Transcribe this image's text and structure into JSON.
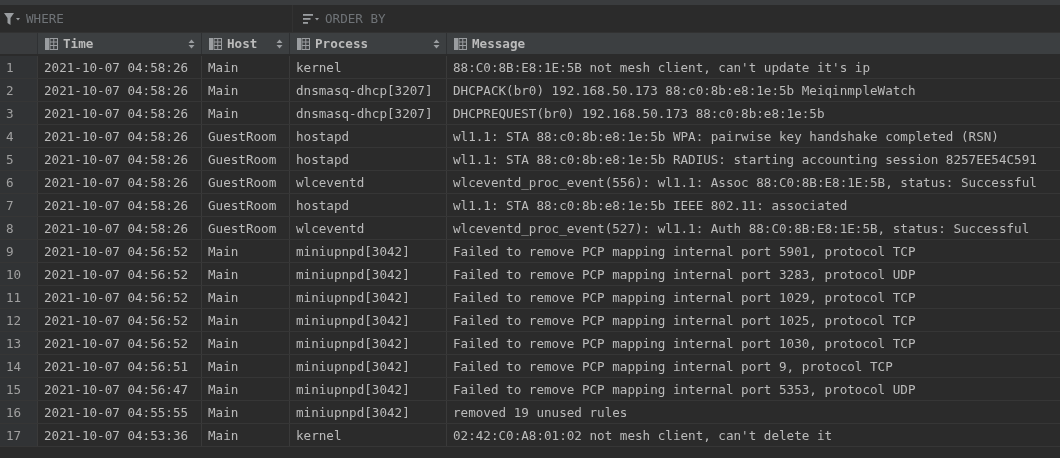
{
  "filter_bar": {
    "where": {
      "placeholder": "WHERE"
    },
    "order_by": {
      "placeholder": "ORDER BY"
    }
  },
  "table": {
    "columns": [
      {
        "label": "Time",
        "sortable": true
      },
      {
        "label": "Host",
        "sortable": true
      },
      {
        "label": "Process",
        "sortable": true
      },
      {
        "label": "Message",
        "sortable": false
      }
    ],
    "rows": [
      {
        "index": "1",
        "cells": [
          "2021-10-07 04:58:26",
          "Main",
          "kernel",
          "88:C0:8B:E8:1E:5B not mesh client, can't update it's ip"
        ]
      },
      {
        "index": "2",
        "cells": [
          "2021-10-07 04:58:26",
          "Main",
          "dnsmasq-dhcp[3207]",
          "DHCPACK(br0) 192.168.50.173 88:c0:8b:e8:1e:5b MeiqinmpleWatch"
        ]
      },
      {
        "index": "3",
        "cells": [
          "2021-10-07 04:58:26",
          "Main",
          "dnsmasq-dhcp[3207]",
          "DHCPREQUEST(br0) 192.168.50.173 88:c0:8b:e8:1e:5b"
        ]
      },
      {
        "index": "4",
        "cells": [
          "2021-10-07 04:58:26",
          "GuestRoom",
          "hostapd",
          "wl1.1: STA 88:c0:8b:e8:1e:5b WPA: pairwise key handshake completed (RSN)"
        ]
      },
      {
        "index": "5",
        "cells": [
          "2021-10-07 04:58:26",
          "GuestRoom",
          "hostapd",
          "wl1.1: STA 88:c0:8b:e8:1e:5b RADIUS: starting accounting session 8257EE54C591"
        ]
      },
      {
        "index": "6",
        "cells": [
          "2021-10-07 04:58:26",
          "GuestRoom",
          "wlceventd",
          "wlceventd_proc_event(556): wl1.1: Assoc 88:C0:8B:E8:1E:5B, status: Successful"
        ]
      },
      {
        "index": "7",
        "cells": [
          "2021-10-07 04:58:26",
          "GuestRoom",
          "hostapd",
          "wl1.1: STA 88:c0:8b:e8:1e:5b IEEE 802.11: associated"
        ]
      },
      {
        "index": "8",
        "cells": [
          "2021-10-07 04:58:26",
          "GuestRoom",
          "wlceventd",
          "wlceventd_proc_event(527): wl1.1: Auth 88:C0:8B:E8:1E:5B, status: Successful"
        ]
      },
      {
        "index": "9",
        "cells": [
          "2021-10-07 04:56:52",
          "Main",
          "miniupnpd[3042]",
          "Failed to remove PCP mapping internal port 5901, protocol TCP"
        ]
      },
      {
        "index": "10",
        "cells": [
          "2021-10-07 04:56:52",
          "Main",
          "miniupnpd[3042]",
          "Failed to remove PCP mapping internal port 3283, protocol UDP"
        ]
      },
      {
        "index": "11",
        "cells": [
          "2021-10-07 04:56:52",
          "Main",
          "miniupnpd[3042]",
          "Failed to remove PCP mapping internal port 1029, protocol TCP"
        ]
      },
      {
        "index": "12",
        "cells": [
          "2021-10-07 04:56:52",
          "Main",
          "miniupnpd[3042]",
          "Failed to remove PCP mapping internal port 1025, protocol TCP"
        ]
      },
      {
        "index": "13",
        "cells": [
          "2021-10-07 04:56:52",
          "Main",
          "miniupnpd[3042]",
          "Failed to remove PCP mapping internal port 1030, protocol TCP"
        ]
      },
      {
        "index": "14",
        "cells": [
          "2021-10-07 04:56:51",
          "Main",
          "miniupnpd[3042]",
          "Failed to remove PCP mapping internal port 9, protocol TCP"
        ]
      },
      {
        "index": "15",
        "cells": [
          "2021-10-07 04:56:47",
          "Main",
          "miniupnpd[3042]",
          "Failed to remove PCP mapping internal port 5353, protocol UDP"
        ]
      },
      {
        "index": "16",
        "cells": [
          "2021-10-07 04:55:55",
          "Main",
          "miniupnpd[3042]",
          "removed 19 unused rules"
        ]
      },
      {
        "index": "17",
        "cells": [
          "2021-10-07 04:53:36",
          "Main",
          "kernel",
          "02:42:C0:A8:01:02 not mesh client, can't delete it"
        ]
      }
    ]
  }
}
